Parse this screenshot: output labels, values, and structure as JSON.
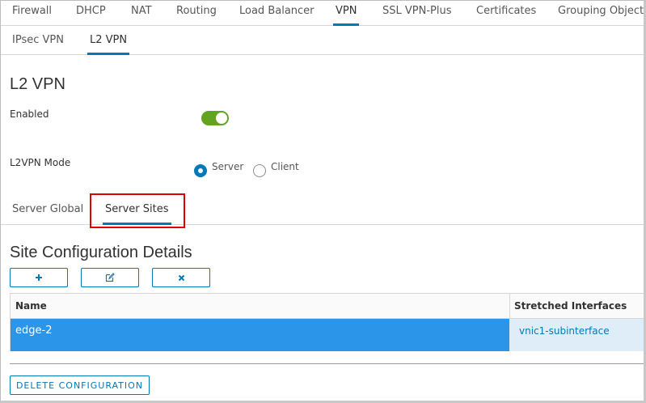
{
  "top_tabs": [
    "Firewall",
    "DHCP",
    "NAT",
    "Routing",
    "Load Balancer",
    "VPN",
    "SSL VPN-Plus",
    "Certificates",
    "Grouping Objects"
  ],
  "sub_tabs": [
    "IPsec VPN",
    "L2 VPN"
  ],
  "page_title": "L2 VPN",
  "enabled_label": "Enabled",
  "mode": {
    "label": "L2VPN Mode",
    "options": [
      "Server",
      "Client"
    ],
    "selected": "Server"
  },
  "inner_tabs": [
    "Server Global",
    "Server Sites"
  ],
  "section_title": "Site Configuration Details",
  "toolbar": {
    "add_icon": "plus-icon",
    "edit_icon": "edit-icon",
    "delete_icon": "close-icon"
  },
  "grid": {
    "columns": [
      "Name",
      "Stretched Interfaces"
    ],
    "rows": [
      {
        "name": "edge-2",
        "interfaces": "vnic1-subinterface"
      }
    ]
  },
  "delete_config_label": "DELETE CONFIGURATION",
  "colors": {
    "accent": "#0079b8",
    "toggle_on": "#62a420",
    "selected_row": "#2b96e9",
    "highlight": "#e00000"
  }
}
